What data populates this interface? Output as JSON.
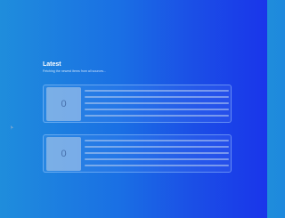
{
  "section": {
    "title": "Latest",
    "subtitle": "Fetching the newest items from all sources..."
  },
  "cards": [
    {
      "thumb_label": "0"
    },
    {
      "thumb_label": "0"
    }
  ]
}
